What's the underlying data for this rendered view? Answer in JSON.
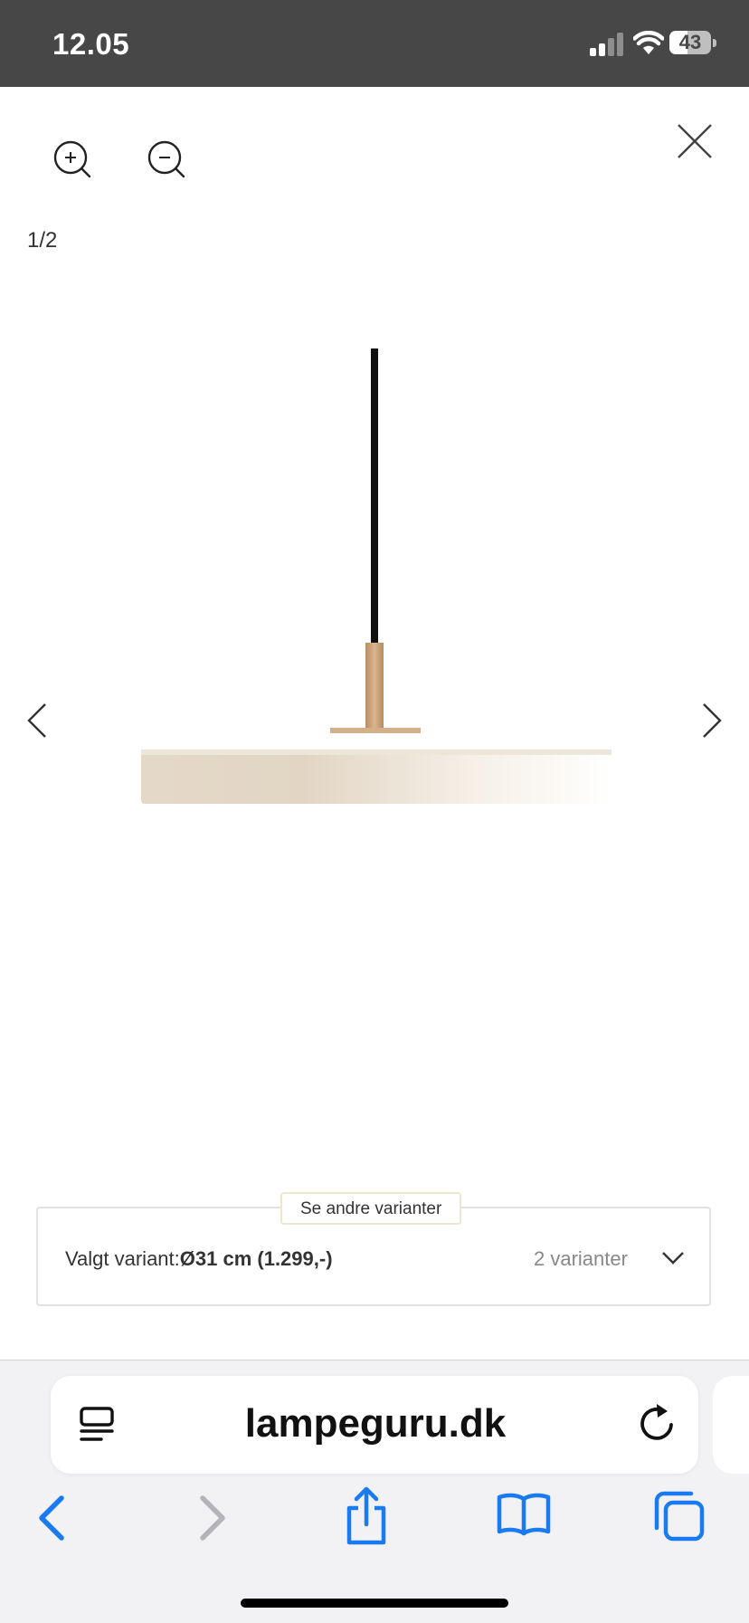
{
  "status_bar": {
    "time": "12.05",
    "battery": "43",
    "battery_level": 0.43
  },
  "viewer": {
    "counter": "1/2"
  },
  "variants": {
    "tag": "Se andre varianter",
    "selected_label": "Valgt variant:",
    "selected_value": "Ø31 cm (1.299,-)",
    "count": "2 varianter"
  },
  "browser": {
    "url": "lampeguru.dk"
  },
  "colors": {
    "status_bar": "#474747",
    "safari_blue": "#1a7bf0",
    "lamp_shade": "#e8dccd",
    "lamp_brass": "#c9a27a"
  }
}
